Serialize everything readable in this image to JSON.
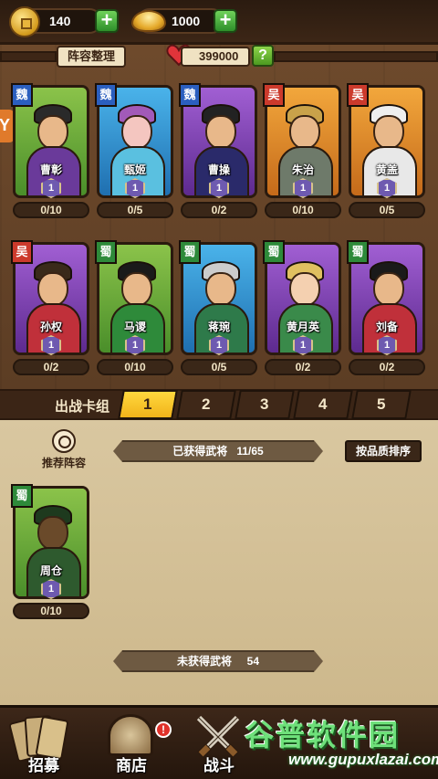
{
  "resources": {
    "coins": "140",
    "gold": "1000"
  },
  "header": {
    "lineup_tab": "阵容整理",
    "power": "399000",
    "help": "?"
  },
  "side_tag": "Y",
  "heroes_row1": [
    {
      "faction": "魏",
      "name": "曹彰",
      "level": "1",
      "count": "0/10"
    },
    {
      "faction": "魏",
      "name": "甄姬",
      "level": "1",
      "count": "0/5"
    },
    {
      "faction": "魏",
      "name": "曹操",
      "level": "1",
      "count": "0/2"
    },
    {
      "faction": "吴",
      "name": "朱治",
      "level": "1",
      "count": "0/10"
    },
    {
      "faction": "吴",
      "name": "黄盖",
      "level": "1",
      "count": "0/5"
    }
  ],
  "heroes_row2": [
    {
      "faction": "吴",
      "name": "孙权",
      "level": "1",
      "count": "0/2"
    },
    {
      "faction": "蜀",
      "name": "马谡",
      "level": "1",
      "count": "0/10"
    },
    {
      "faction": "蜀",
      "name": "蒋琬",
      "level": "1",
      "count": "0/5"
    },
    {
      "faction": "蜀",
      "name": "黄月英",
      "level": "1",
      "count": "0/2"
    },
    {
      "faction": "蜀",
      "name": "刘备",
      "level": "1",
      "count": "0/2"
    }
  ],
  "deck": {
    "label": "出战卡组",
    "tabs": [
      "1",
      "2",
      "3",
      "4",
      "5"
    ],
    "active": "1"
  },
  "collection": {
    "recommend_label": "推荐阵容",
    "obtained_label": "已获得武将",
    "obtained_count": "11/65",
    "sort_label": "按品质排序",
    "unobtained_label": "未获得武将",
    "unobtained_count": "54"
  },
  "owned_hero": {
    "faction": "蜀",
    "name": "周仓",
    "level": "1",
    "count": "0/10"
  },
  "nav": {
    "recruit": "招募",
    "shop": "商店",
    "shop_badge": "!",
    "battle": "战斗"
  },
  "watermark": {
    "title": "谷普软件园",
    "url": "www.gupuxlazai.com"
  },
  "colors": {
    "wei": "#2b5fbf",
    "wu": "#cc3a2c",
    "shu": "#2e8a3a",
    "deck_active": "#f1b31a",
    "plus_button": "#2e8e2a"
  }
}
